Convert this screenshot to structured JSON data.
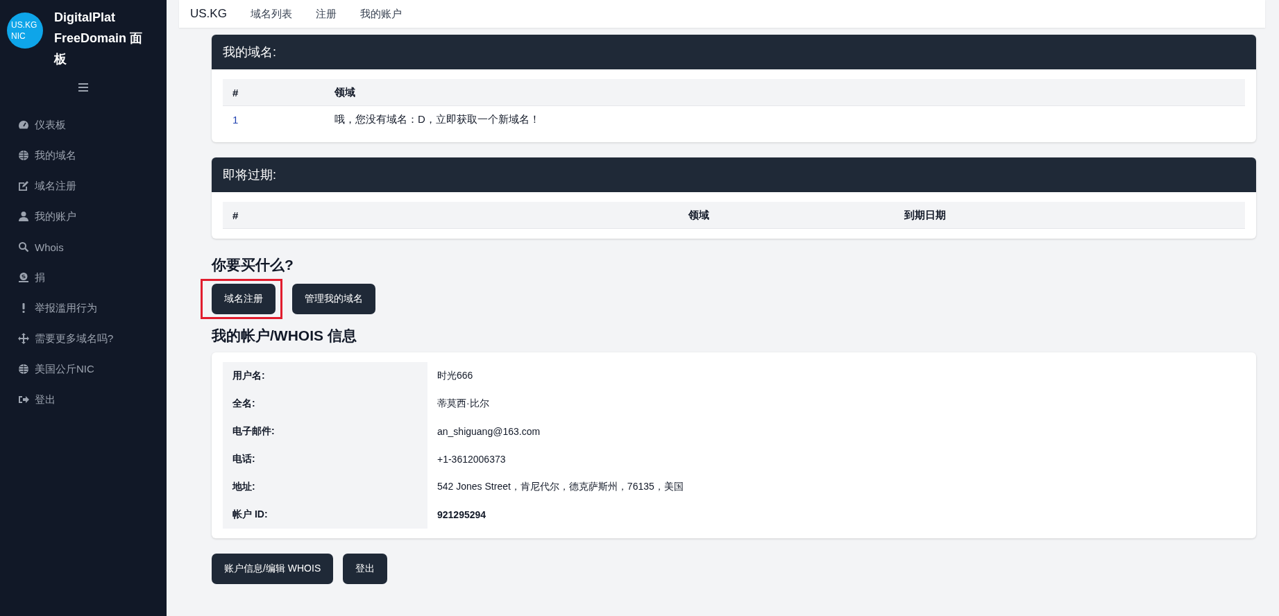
{
  "sidebar": {
    "logo": "US.KG NIC",
    "title": "DigitalPlat FreeDomain 面板",
    "items": [
      {
        "label": "仪表板",
        "selected": false
      },
      {
        "label": "我的域名",
        "selected": false
      },
      {
        "label": "域名注册",
        "selected": false
      },
      {
        "label": "我的账户",
        "selected": false
      },
      {
        "label": "Whois",
        "selected": false
      },
      {
        "label": "捐",
        "selected": false
      },
      {
        "label": "举报滥用行为",
        "selected": false
      },
      {
        "label": "需要更多域名吗?",
        "selected": false
      },
      {
        "label": "美国公斤NIC",
        "selected": false
      },
      {
        "label": "登出",
        "selected": false
      }
    ]
  },
  "top_nav": [
    "US.KG",
    "域名列表",
    "注册",
    "我的账户"
  ],
  "my_domains": {
    "title": "我的域名:",
    "columns": [
      "#",
      "领域"
    ],
    "rows": [
      [
        "1",
        "哦，您没有域名：D，立即获取一个新域名！"
      ]
    ]
  },
  "expiring": {
    "title": "即将过期:",
    "columns": [
      "#",
      "领域",
      "到期日期"
    ]
  },
  "buy": {
    "heading": "你要买什么?",
    "buttons": [
      {
        "label": "域名注册",
        "highlighted": true
      },
      {
        "label": "管理我的域名",
        "highlighted": false
      }
    ]
  },
  "account": {
    "heading": "我的帐户/WHOIS 信息",
    "fields": [
      {
        "label": "用户名:",
        "value": "时光666",
        "bold": false
      },
      {
        "label": "全名:",
        "value": "蒂莫西·比尔",
        "bold": false
      },
      {
        "label": "电子邮件:",
        "value": "an_shiguang@163.com",
        "bold": false
      },
      {
        "label": "电话:",
        "value": "+1-3612006373",
        "bold": false
      },
      {
        "label": "地址:",
        "value": "542 Jones Street，肯尼代尔，德克萨斯州，76135，美国",
        "bold": false
      },
      {
        "label": "帐户 ID:",
        "value": "921295294",
        "bold": true
      }
    ],
    "buttons": [
      "账户信息/编辑 WHOIS",
      "登出"
    ]
  }
}
